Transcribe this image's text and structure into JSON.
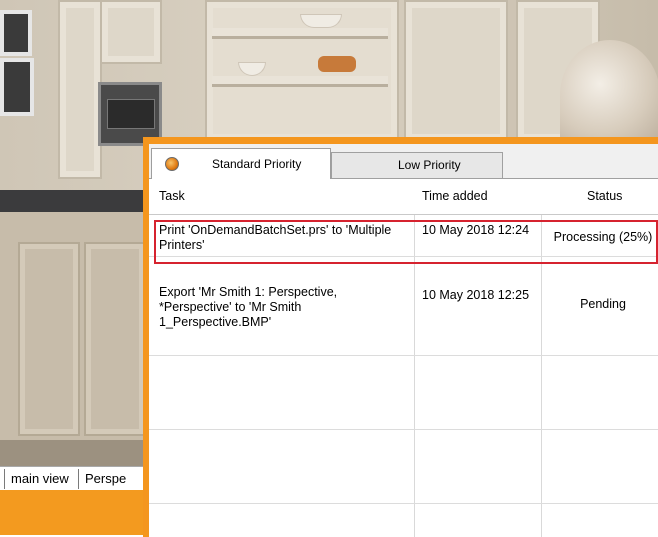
{
  "dialog": {
    "tabs": [
      {
        "label": "Standard Priority",
        "active": true
      },
      {
        "label": "Low Priority",
        "active": false
      }
    ],
    "columns": {
      "task": "Task",
      "time_added": "Time added",
      "status": "Status"
    },
    "rows": [
      {
        "task": "Print 'OnDemandBatchSet.prs' to 'Multiple Printers'",
        "time": "10 May 2018 12:24",
        "status": "Processing (25%)"
      },
      {
        "task": "Export 'Mr Smith 1: Perspective, *Perspective' to 'Mr Smith 1_Perspective.BMP'",
        "time": "10 May 2018 12:25",
        "status": "Pending"
      }
    ]
  },
  "view_tabs": [
    "main view",
    "Perspe"
  ],
  "colors": {
    "accent": "#f4961e",
    "highlight": "#d6232f"
  }
}
